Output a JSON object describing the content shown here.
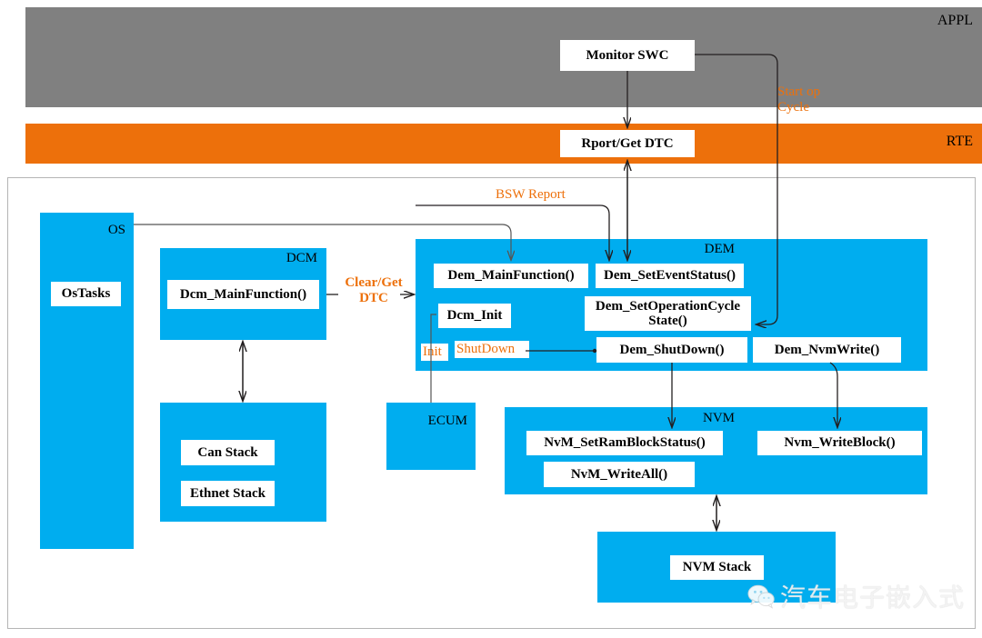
{
  "layers": {
    "appl": {
      "label": "APPL",
      "color": "#808080"
    },
    "rte": {
      "label": "RTE",
      "color": "#ED700B"
    },
    "bsw": {
      "border_color": "#b5b5b5"
    }
  },
  "colors": {
    "module_blue": "#00ADEF",
    "accent_orange": "#ED700B",
    "appl_gray": "#808080",
    "box_white": "#FFFFFF",
    "line_black": "#231f20"
  },
  "appl": {
    "monitor_swc": "Monitor SWC"
  },
  "rte": {
    "rport_get_dtc": "Rport/Get DTC"
  },
  "modules": {
    "os": {
      "title": "OS",
      "items": [
        "OsTasks"
      ]
    },
    "dcm": {
      "title": "DCM",
      "items": [
        "Dcm_MainFunction()"
      ]
    },
    "comstack": {
      "items": [
        "Can Stack",
        "Ethnet Stack"
      ]
    },
    "ecum": {
      "title": "ECUM",
      "items": []
    },
    "dem": {
      "title": "DEM",
      "items": [
        "Dem_MainFunction()",
        "Dem_SetEventStatus()",
        "Dcm_Init",
        "Dem_SetOperationCycle\nState()",
        "Dem_ShutDown()",
        "Dem_NvmWrite()"
      ]
    },
    "nvm": {
      "title": "NVM",
      "items": [
        "NvM_SetRamBlockStatus()",
        "Nvm_WriteBlock()",
        "NvM_WriteAll()"
      ]
    },
    "nvmstack": {
      "items": [
        "NVM Stack"
      ]
    }
  },
  "edge_labels": {
    "start_op_cycle": "Start op\nCycle",
    "bsw_report": "BSW Report",
    "clear_get_dtc": "Clear/Get\nDTC",
    "init": "Init",
    "shutdown": "ShutDown"
  },
  "watermark": {
    "text": "汽车电子嵌入式"
  }
}
